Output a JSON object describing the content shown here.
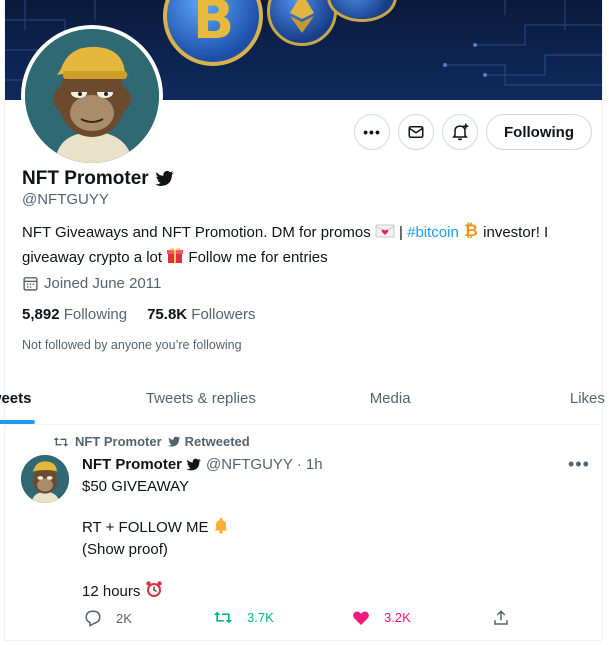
{
  "profile": {
    "name": "NFT Promoter",
    "handle": "@NFTGUYY",
    "bio": {
      "part1": "NFT Giveaways and NFT Promotion. DM for promos ",
      "part2": " | ",
      "hashtag": "#bitcoin",
      "part3": " investor! I giveaway crypto a lot ",
      "part4": " Follow me for entries"
    },
    "joined": "Joined June 2011",
    "following_count": "5,892",
    "following_label": "Following",
    "followers_count": "75.8K",
    "followers_label": "Followers",
    "not_followed": "Not followed by anyone you’re following",
    "follow_button": "Following"
  },
  "tabs": [
    {
      "label": "Tweets",
      "active": true
    },
    {
      "label": "Tweets & replies",
      "active": false
    },
    {
      "label": "Media",
      "active": false
    },
    {
      "label": "Likes",
      "active": false
    }
  ],
  "tweet": {
    "retweeted_by": "NFT Promoter",
    "retweeted_label": "Retweeted",
    "author_name": "NFT Promoter",
    "author_handle": "@NFTGUYY",
    "separator": "·",
    "time": "1h",
    "lines": [
      "$50 GIVEAWAY",
      "",
      "RT + FOLLOW ME",
      "(Show proof)",
      "",
      "12 hours"
    ],
    "replies": "2K",
    "retweets": "3.7K",
    "likes": "3.2K"
  },
  "colors": {
    "accent": "#1d9bf0",
    "retweet_green": "#00ba7c",
    "like_pink": "#f91880",
    "muted": "#536471",
    "bitcoin_orange": "#f7931a"
  },
  "icons": [
    "verified-badge-icon",
    "more-icon",
    "mail-icon",
    "bell-plus-icon",
    "calendar-icon",
    "retweet-icon",
    "reply-icon",
    "heart-icon",
    "share-icon",
    "envelope-heart-emoji",
    "bitcoin-emoji",
    "gift-emoji",
    "bell-emoji",
    "alarm-clock-emoji"
  ]
}
